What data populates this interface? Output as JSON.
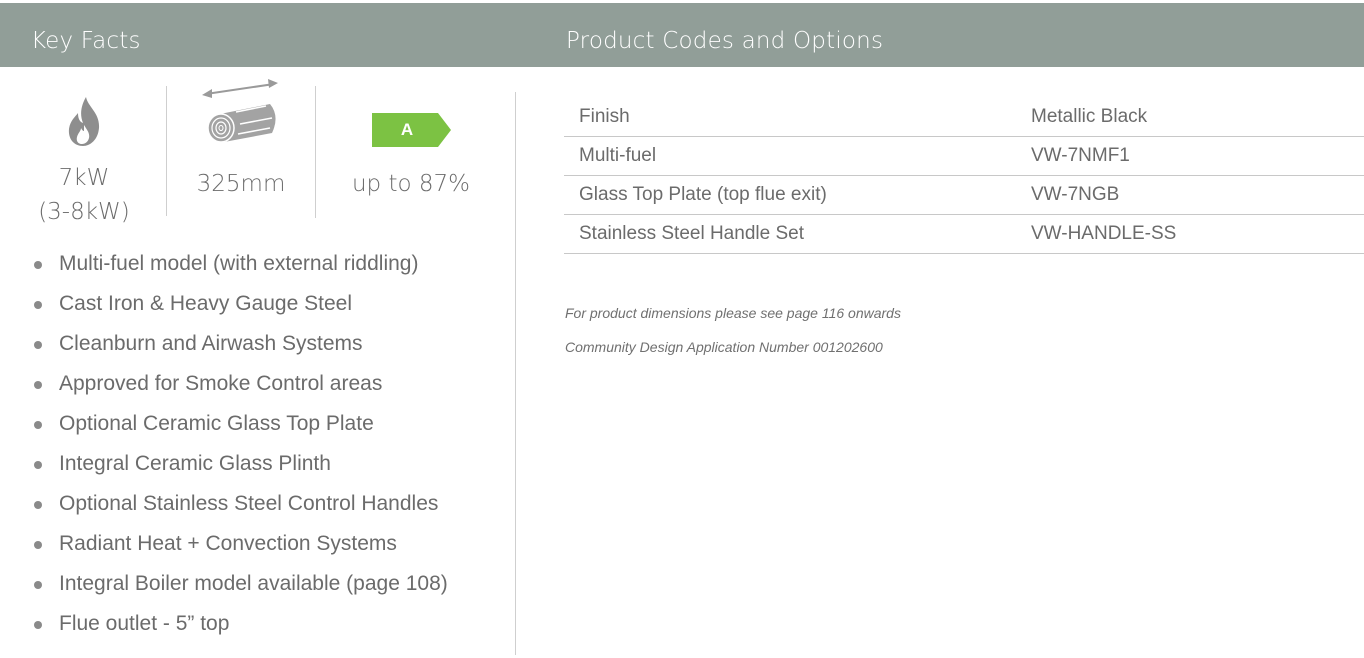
{
  "header": {
    "left_title": "Key Facts",
    "right_title": "Product Codes and Options"
  },
  "colors": {
    "header_bg": "#919e98",
    "badge_green": "#7cc243",
    "text": "#6b6b6b"
  },
  "key_facts": [
    {
      "icon": "flame-icon",
      "value_line1": "7kW",
      "value_line2": "(3-8kW)"
    },
    {
      "icon": "log-length-icon",
      "value_line1": "325mm"
    },
    {
      "icon": "efficiency-badge",
      "badge_label": "A",
      "value_line1": "up to 87%"
    }
  ],
  "features": [
    "Multi-fuel model (with external riddling)",
    "Cast Iron & Heavy Gauge Steel",
    "Cleanburn and Airwash Systems",
    "Approved for Smoke Control areas",
    "Optional Ceramic Glass Top Plate",
    "Integral Ceramic Glass Plinth",
    "Optional Stainless Steel Control Handles",
    "Radiant Heat + Convection Systems",
    "Integral Boiler model available (page 108)",
    "Flue outlet - 5” top"
  ],
  "product_codes": [
    {
      "label": "Finish",
      "code": "Metallic Black"
    },
    {
      "label": "Multi-fuel",
      "code": "VW-7NMF1"
    },
    {
      "label": "Glass Top Plate (top flue exit)",
      "code": "VW-7NGB"
    },
    {
      "label": "Stainless Steel Handle Set",
      "code": "VW-HANDLE-SS"
    }
  ],
  "notes": {
    "dimensions": "For product dimensions please see page 116 onwards",
    "design_number": "Community Design Application Number 001202600"
  }
}
